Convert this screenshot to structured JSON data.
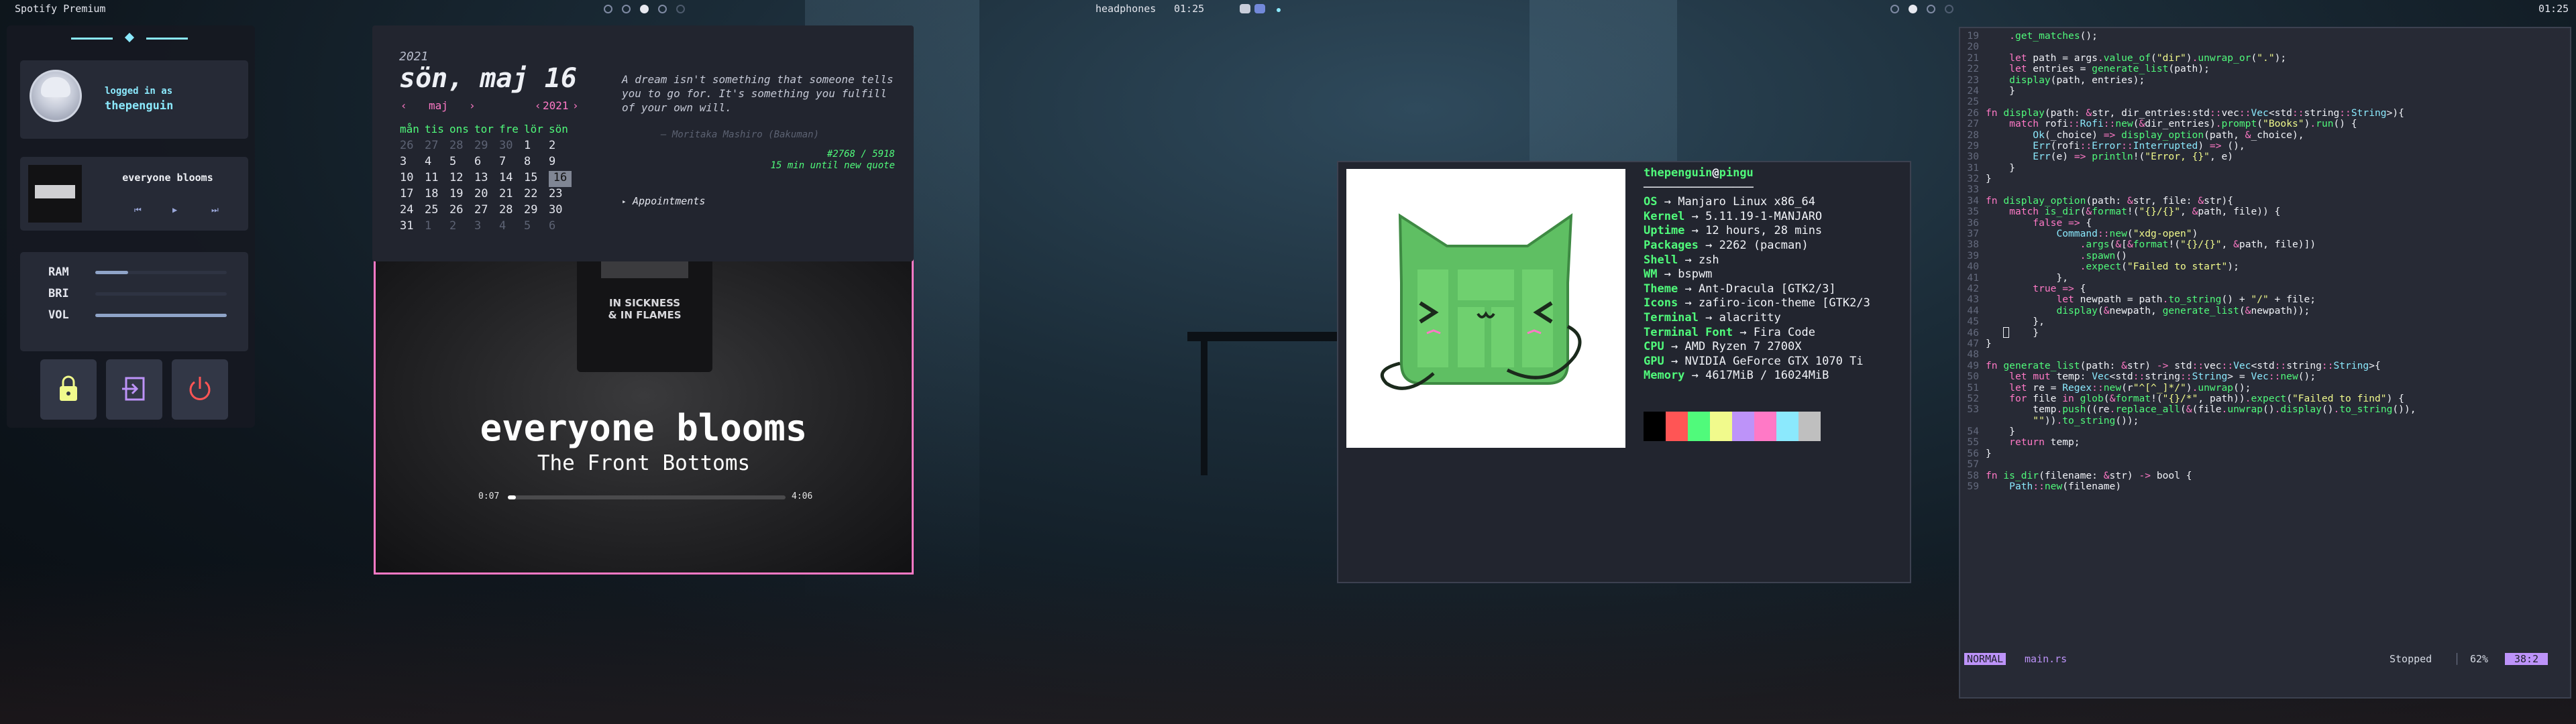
{
  "top_bar_left": {
    "title": "Spotify Premium",
    "center": "headphones",
    "time": "01:25"
  },
  "top_bar_right": {
    "time": "01:25"
  },
  "dashboard": {
    "profile": {
      "logged_in_label": "logged in as",
      "username": "thepenguin"
    },
    "mini_player": {
      "song": "everyone blooms"
    },
    "stats": [
      {
        "label": "RAM",
        "level": 0.25
      },
      {
        "label": "BRI",
        "level": 0.0
      },
      {
        "label": "VOL",
        "level": 1.0
      }
    ],
    "accent_color": "#8be9fd",
    "icons": [
      "lock-icon",
      "logout-icon",
      "power-icon"
    ]
  },
  "calendar": {
    "year": "2021",
    "date": "sön, maj 16",
    "month_nav": {
      "prev": "‹",
      "month": "maj",
      "next": "›",
      "year_prev": "‹",
      "year": "2021",
      "year_next": "›"
    },
    "weekdays": [
      "mån",
      "tis",
      "ons",
      "tor",
      "fre",
      "lör",
      "sön"
    ],
    "weeks": [
      [
        "26",
        "27",
        "28",
        "29",
        "30",
        "1",
        "2"
      ],
      [
        "3",
        "4",
        "5",
        "6",
        "7",
        "8",
        "9"
      ],
      [
        "10",
        "11",
        "12",
        "13",
        "14",
        "15",
        "16"
      ],
      [
        "17",
        "18",
        "19",
        "20",
        "21",
        "22",
        "23"
      ],
      [
        "24",
        "25",
        "26",
        "27",
        "28",
        "29",
        "30"
      ],
      [
        "31",
        "1",
        "2",
        "3",
        "4",
        "5",
        "6"
      ]
    ],
    "quote": "A dream isn't something that someone tells you to go for. It's something you fulfill of your own will.",
    "quote_author": "— Moritaka Mashiro (Bakuman)",
    "quote_count": "#2768 / 5918",
    "quote_next": "15 min until new quote",
    "appointments": "Appointments"
  },
  "spotify": {
    "song": "everyone blooms",
    "artist": "The Front Bottoms",
    "album_text": [
      "IN SICKNESS",
      "& IN FLAMES"
    ],
    "elapsed": "0:07",
    "duration": "4:06",
    "progress": 0.03,
    "accent_color": "#ff79c6"
  },
  "neofetch": {
    "user": "thepenguin",
    "at": "@",
    "host": "pingu",
    "separator": "────────────────",
    "rows": [
      {
        "key": "OS",
        "value": "Manjaro Linux x86_64"
      },
      {
        "key": "Kernel",
        "value": "5.11.19-1-MANJARO"
      },
      {
        "key": "Uptime",
        "value": "12 hours, 28 mins"
      },
      {
        "key": "Packages",
        "value": "2262 (pacman)"
      },
      {
        "key": "Shell",
        "value": "zsh"
      },
      {
        "key": "WM",
        "value": "bspwm"
      },
      {
        "key": "Theme",
        "value": "Ant-Dracula [GTK2/3]"
      },
      {
        "key": "Icons",
        "value": "zafiro-icon-theme [GTK2/3"
      },
      {
        "key": "Terminal",
        "value": "alacritty"
      },
      {
        "key": "Terminal Font",
        "value": "Fira Code"
      },
      {
        "key": "CPU",
        "value": "AMD Ryzen 7 2700X"
      },
      {
        "key": "GPU",
        "value": "NVIDIA GeForce GTX 1070 Ti"
      },
      {
        "key": "Memory",
        "value": "4617MiB / 16024MiB"
      }
    ],
    "arrow": "→",
    "swatch_colors": [
      "#000000",
      "#ff5555",
      "#50fa7b",
      "#f1fa8c",
      "#bd93f9",
      "#ff79c6",
      "#8be9fd",
      "#bfbfbf"
    ]
  },
  "editor": {
    "mode": "NORMAL",
    "filename": "main.rs",
    "status": "Stopped",
    "percent": "62%",
    "position": "38:2",
    "lines": [
      {
        "n": "19",
        "t": "    .get_matches();"
      },
      {
        "n": "20",
        "t": ""
      },
      {
        "n": "21",
        "t": "    let path = args.value_of(\"dir\").unwrap_or(\".\");"
      },
      {
        "n": "22",
        "t": "    let entries = generate_list(path);"
      },
      {
        "n": "23",
        "t": "    display(path, entries);"
      },
      {
        "n": "24",
        "t": "    }"
      },
      {
        "n": "25",
        "t": ""
      },
      {
        "n": "26",
        "t": "fn display(path: &str, dir_entries:std::vec::Vec<std::string::String>){"
      },
      {
        "n": "27",
        "t": "    match rofi::Rofi::new(&dir_entries).prompt(\"Books\").run() {"
      },
      {
        "n": "28",
        "t": "        Ok(_choice) => display_option(path, &_choice),"
      },
      {
        "n": "29",
        "t": "        Err(rofi::Error::Interrupted) => (),"
      },
      {
        "n": "30",
        "t": "        Err(e) => println!(\"Error, {}\", e)"
      },
      {
        "n": "31",
        "t": "    }"
      },
      {
        "n": "32",
        "t": "}"
      },
      {
        "n": "33",
        "t": ""
      },
      {
        "n": "34",
        "t": "fn display_option(path: &str, file: &str){"
      },
      {
        "n": "35",
        "t": "    match is_dir(&format!(\"{}/{}\", &path, file)) {"
      },
      {
        "n": "36",
        "t": "        false => {"
      },
      {
        "n": "37",
        "t": "            Command::new(\"xdg-open\")"
      },
      {
        "n": "38",
        "t": "                .args(&[&format!(\"{}/{}\", &path, file)])"
      },
      {
        "n": "39",
        "t": "                .spawn()"
      },
      {
        "n": "40",
        "t": "                .expect(\"Failed to start\");"
      },
      {
        "n": "41",
        "t": "            },"
      },
      {
        "n": "42",
        "t": "        true => {"
      },
      {
        "n": "43",
        "t": "            let newpath = path.to_string() + \"/\" + file;"
      },
      {
        "n": "44",
        "t": "            display(&newpath, generate_list(&newpath));"
      },
      {
        "n": "45",
        "t": "        },"
      },
      {
        "n": "46",
        "t": "        }"
      },
      {
        "n": "47",
        "t": "}"
      },
      {
        "n": "48",
        "t": ""
      },
      {
        "n": "49",
        "t": "fn generate_list(path: &str) -> std::vec::Vec<std::string::String>{"
      },
      {
        "n": "50",
        "t": "    let mut temp: Vec<std::string::String> = Vec::new();"
      },
      {
        "n": "51",
        "t": "    let re = Regex::new(r\"^[^_]*/\").unwrap();"
      },
      {
        "n": "52",
        "t": "    for file in glob(&format!(\"{}/*\", path)).expect(\"Failed to find\") {"
      },
      {
        "n": "53",
        "t": "        temp.push((re.replace_all(&(file.unwrap().display().to_string()),"
      },
      {
        "n": "",
        "t": "        \"\")).to_string());"
      },
      {
        "n": "54",
        "t": "    }"
      },
      {
        "n": "55",
        "t": "    return temp;"
      },
      {
        "n": "56",
        "t": "}"
      },
      {
        "n": "57",
        "t": ""
      },
      {
        "n": "58",
        "t": "fn is_dir(filename: &str) -> bool {"
      },
      {
        "n": "59",
        "t": "    Path::new(filename)"
      }
    ]
  }
}
